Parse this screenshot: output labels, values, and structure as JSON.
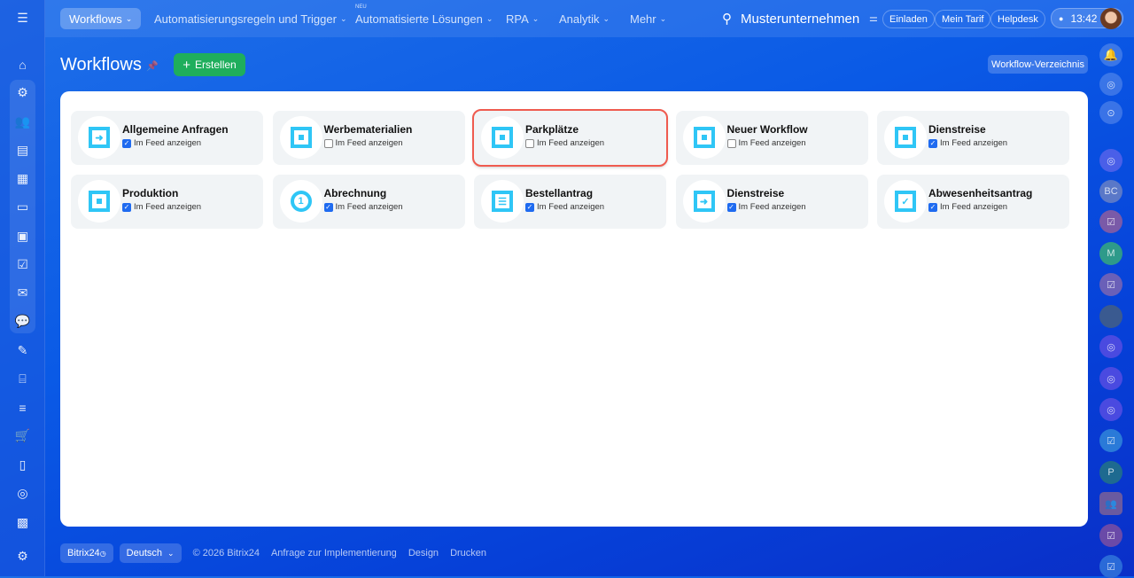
{
  "topbar": {
    "nav": [
      {
        "label": "Workflows"
      },
      {
        "label": "Automatisierungsregeln und Trigger"
      },
      {
        "label": "Automatisierte Lösungen",
        "badge": "NEU"
      },
      {
        "label": "RPA"
      },
      {
        "label": "Analytik"
      },
      {
        "label": "Mehr"
      }
    ],
    "company": "Musterunternehmen",
    "invite": "Einladen",
    "tariff": "Mein Tarif",
    "helpdesk": "Helpdesk",
    "time": "13:42"
  },
  "page": {
    "title": "Workflows",
    "create_label": "Erstellen",
    "directory_label": "Workflow-Verzeichnis"
  },
  "feed_label": "Im Feed anzeigen",
  "cards": [
    {
      "title": "Allgemeine Anfragen",
      "checked": true,
      "icon": "exit-icon"
    },
    {
      "title": "Werbematerialien",
      "checked": false,
      "icon": "square-icon"
    },
    {
      "title": "Parkplätze",
      "checked": false,
      "icon": "square-icon",
      "highlighted": true
    },
    {
      "title": "Neuer Workflow",
      "checked": false,
      "icon": "square-icon"
    },
    {
      "title": "Dienstreise",
      "checked": true,
      "icon": "square-icon"
    },
    {
      "title": "Produktion",
      "checked": true,
      "icon": "square-icon"
    },
    {
      "title": "Abrechnung",
      "checked": true,
      "icon": "number-one-icon"
    },
    {
      "title": "Bestellantrag",
      "checked": true,
      "icon": "list-icon"
    },
    {
      "title": "Dienstreise",
      "checked": true,
      "icon": "arrow-icon"
    },
    {
      "title": "Abwesenheitsantrag",
      "checked": true,
      "icon": "edit-icon"
    }
  ],
  "rightbar": {
    "avatars": [
      "BC",
      "M",
      "P"
    ]
  },
  "footer": {
    "brand": "Bitrix24",
    "language": "Deutsch",
    "copyright": "© 2026 Bitrix24",
    "links": [
      "Anfrage zur Implementierung",
      "Design",
      "Drucken"
    ]
  },
  "colors": {
    "accent": "#2fc6f6",
    "create": "#1fae5c",
    "highlight": "#ef5b4f"
  }
}
